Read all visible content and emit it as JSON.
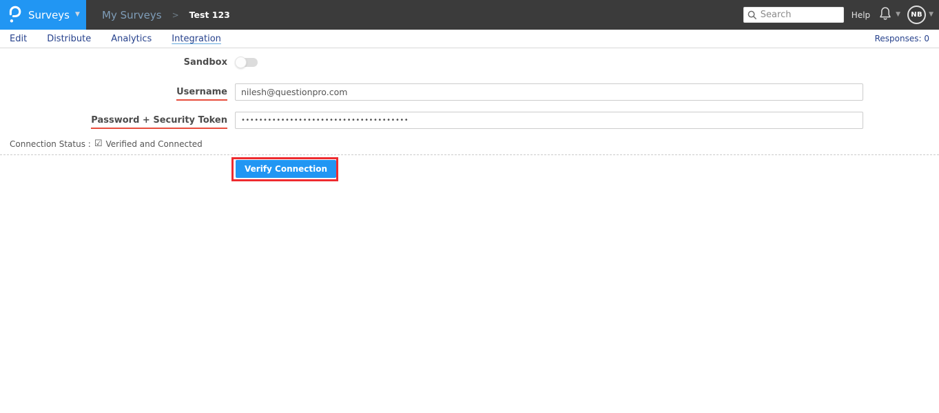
{
  "colors": {
    "accent_blue": "#2196f3",
    "navbar_dark": "#3b3b3b",
    "tab_navy": "#26418c",
    "label_underline_red": "#e74c3c",
    "annotation_red": "#ee2b2f"
  },
  "navbar": {
    "app_menu_label": "Surveys",
    "logo": "questionpro-logo",
    "breadcrumb": {
      "parent": "My Surveys",
      "separator": ">",
      "current": "Test 123"
    },
    "search_placeholder": "Search",
    "help_label": "Help",
    "avatar_initials": "NB"
  },
  "tabs": {
    "items": [
      {
        "label": "Edit",
        "active": false
      },
      {
        "label": "Distribute",
        "active": false
      },
      {
        "label": "Analytics",
        "active": false
      },
      {
        "label": "Integration",
        "active": true
      }
    ],
    "responses_label": "Responses: 0"
  },
  "form": {
    "sandbox": {
      "label": "Sandbox",
      "enabled": false
    },
    "username": {
      "label": "Username",
      "value": "nilesh@questionpro.com"
    },
    "password": {
      "label": "Password + Security Token",
      "value": "••••••••••••••••••••••••••••••••••••••"
    },
    "connection_status": {
      "label": "Connection Status :",
      "checkbox_glyph": "☑",
      "value": "Verified and Connected"
    },
    "verify_button_label": "Verify Connection"
  }
}
